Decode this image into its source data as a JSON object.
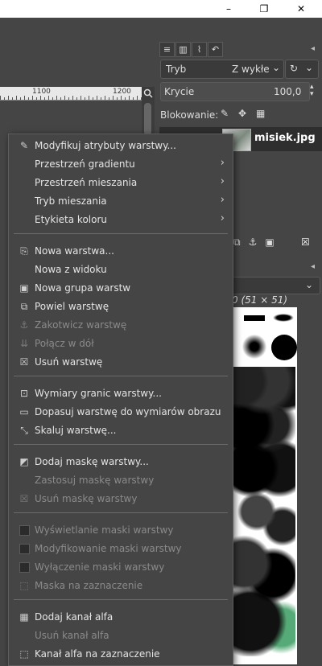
{
  "window_controls": {
    "minimize": "–",
    "restore": "❐",
    "close": "✕"
  },
  "ruler": {
    "labels": [
      "1100",
      "1200"
    ]
  },
  "dock": {
    "mode_label": "Tryb",
    "mode_value": "Z wykłe",
    "opacity_label": "Krycie",
    "opacity_value": "100,0",
    "lock_label": "Blokowanie:",
    "layer_name": "misiek.jpg",
    "brush_info": "0 (51 × 51)"
  },
  "menu": {
    "items": [
      {
        "label": "Modyfikuj atrybuty warstwy...",
        "icon": "edit-attributes-icon",
        "disabled": false,
        "submenu": false
      },
      {
        "label": "Przestrzeń gradientu",
        "icon": "",
        "disabled": false,
        "submenu": true
      },
      {
        "label": "Przestrzeń mieszania",
        "icon": "",
        "disabled": false,
        "submenu": true
      },
      {
        "label": "Tryb mieszania",
        "icon": "",
        "disabled": false,
        "submenu": true
      },
      {
        "label": "Etykieta koloru",
        "icon": "",
        "disabled": false,
        "submenu": true
      },
      {
        "label": "Nowa warstwa...",
        "icon": "new-layer-icon",
        "disabled": false,
        "submenu": false
      },
      {
        "label": "Nowa z widoku",
        "icon": "",
        "disabled": false,
        "submenu": false
      },
      {
        "label": "Nowa grupa warstw",
        "icon": "new-group-icon",
        "disabled": false,
        "submenu": false
      },
      {
        "label": "Powiel warstwę",
        "icon": "duplicate-icon",
        "disabled": false,
        "submenu": false
      },
      {
        "label": "Zakotwicz warstwę",
        "icon": "anchor-icon",
        "disabled": true,
        "submenu": false
      },
      {
        "label": "Połącz w dół",
        "icon": "merge-down-icon",
        "disabled": true,
        "submenu": false
      },
      {
        "label": "Usuń warstwę",
        "icon": "delete-icon",
        "disabled": false,
        "submenu": false
      },
      {
        "label": "Wymiary granic warstwy...",
        "icon": "boundary-size-icon",
        "disabled": false,
        "submenu": false
      },
      {
        "label": "Dopasuj warstwę do wymiarów obrazu",
        "icon": "layer-to-image-size-icon",
        "disabled": false,
        "submenu": false
      },
      {
        "label": "Skaluj warstwę...",
        "icon": "scale-icon",
        "disabled": false,
        "submenu": false
      },
      {
        "label": "Dodaj maskę warstwy...",
        "icon": "add-mask-icon",
        "disabled": false,
        "submenu": false
      },
      {
        "label": "Zastosuj maskę warstwy",
        "icon": "",
        "disabled": true,
        "submenu": false
      },
      {
        "label": "Usuń maskę warstwy",
        "icon": "delete-mask-icon",
        "disabled": true,
        "submenu": false
      },
      {
        "label": "Wyświetlanie maski warstwy",
        "icon": "checkbox-icon",
        "disabled": true,
        "submenu": false
      },
      {
        "label": "Modyfikowanie maski warstwy",
        "icon": "checkbox-icon",
        "disabled": true,
        "submenu": false
      },
      {
        "label": "Wyłączenie maski warstwy",
        "icon": "checkbox-icon",
        "disabled": true,
        "submenu": false
      },
      {
        "label": "Maska na zaznaczenie",
        "icon": "mask-to-selection-icon",
        "disabled": true,
        "submenu": false
      },
      {
        "label": "Dodaj kanał alfa",
        "icon": "alpha-icon",
        "disabled": false,
        "submenu": false
      },
      {
        "label": "Usuń kanał alfa",
        "icon": "",
        "disabled": true,
        "submenu": false
      },
      {
        "label": "Kanał alfa na zaznaczenie",
        "icon": "alpha-to-selection-icon",
        "disabled": false,
        "submenu": false
      }
    ]
  }
}
